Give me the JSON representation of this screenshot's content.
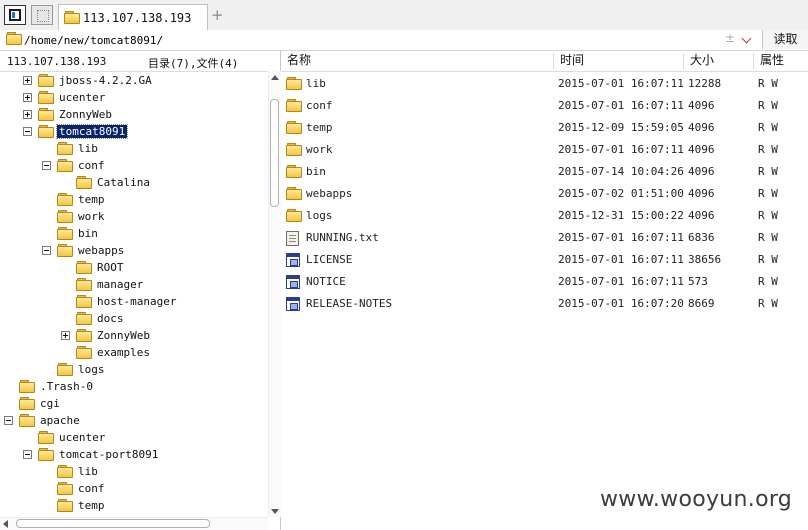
{
  "tabbar": {
    "tab_title": "113.107.138.193",
    "add_tab": "+"
  },
  "address": {
    "path": "/home/new/tomcat8091/",
    "pm": "±",
    "read_label": "读取"
  },
  "left": {
    "host": "113.107.138.193",
    "counts": "目录(7),文件(4)"
  },
  "tree": [
    {
      "label": "jboss-4.2.2.GA",
      "expander": "plus"
    },
    {
      "label": "ucenter",
      "expander": "plus"
    },
    {
      "label": "ZonnyWeb",
      "expander": "plus"
    },
    {
      "label": "tomcat8091",
      "expander": "minus",
      "selected": true
    },
    {
      "label": "lib",
      "expander": "none"
    },
    {
      "label": "conf",
      "expander": "minus"
    },
    {
      "label": "Catalina",
      "expander": "none"
    },
    {
      "label": "temp",
      "expander": "none"
    },
    {
      "label": "work",
      "expander": "none"
    },
    {
      "label": "bin",
      "expander": "none"
    },
    {
      "label": "webapps",
      "expander": "minus"
    },
    {
      "label": "ROOT",
      "expander": "none"
    },
    {
      "label": "manager",
      "expander": "none"
    },
    {
      "label": "host-manager",
      "expander": "none"
    },
    {
      "label": "docs",
      "expander": "none"
    },
    {
      "label": "ZonnyWeb",
      "expander": "plus"
    },
    {
      "label": "examples",
      "expander": "none"
    },
    {
      "label": "logs",
      "expander": "none"
    },
    {
      "label": ".Trash-0",
      "expander": "none"
    },
    {
      "label": "cgi",
      "expander": "none"
    },
    {
      "label": "apache",
      "expander": "minus"
    },
    {
      "label": "ucenter",
      "expander": "none"
    },
    {
      "label": "tomcat-port8091",
      "expander": "minus"
    },
    {
      "label": "lib",
      "expander": "none"
    },
    {
      "label": "conf",
      "expander": "none"
    },
    {
      "label": "temp",
      "expander": "none"
    }
  ],
  "columns": {
    "name": "名称",
    "time": "时间",
    "size": "大小",
    "attr": "属性"
  },
  "files": [
    {
      "icon": "folder",
      "name": "lib",
      "time": "2015-07-01 16:07:11",
      "size": "12288",
      "attr": "R W"
    },
    {
      "icon": "folder",
      "name": "conf",
      "time": "2015-07-01 16:07:11",
      "size": "4096",
      "attr": "R W"
    },
    {
      "icon": "folder",
      "name": "temp",
      "time": "2015-12-09 15:59:05",
      "size": "4096",
      "attr": "R W"
    },
    {
      "icon": "folder",
      "name": "work",
      "time": "2015-07-01 16:07:11",
      "size": "4096",
      "attr": "R W"
    },
    {
      "icon": "folder",
      "name": "bin",
      "time": "2015-07-14 10:04:26",
      "size": "4096",
      "attr": "R W"
    },
    {
      "icon": "folder",
      "name": "webapps",
      "time": "2015-07-02 01:51:00",
      "size": "4096",
      "attr": "R W"
    },
    {
      "icon": "folder",
      "name": "logs",
      "time": "2015-12-31 15:00:22",
      "size": "4096",
      "attr": "R W"
    },
    {
      "icon": "text-file",
      "name": "RUNNING.txt",
      "time": "2015-07-01 16:07:11",
      "size": "6836",
      "attr": "R W"
    },
    {
      "icon": "binary-file",
      "name": "LICENSE",
      "time": "2015-07-01 16:07:11",
      "size": "38656",
      "attr": "R W"
    },
    {
      "icon": "binary-file",
      "name": "NOTICE",
      "time": "2015-07-01 16:07:11",
      "size": "573",
      "attr": "R W"
    },
    {
      "icon": "binary-file",
      "name": "RELEASE-NOTES",
      "time": "2015-07-01 16:07:20",
      "size": "8669",
      "attr": "R W"
    }
  ],
  "watermark": "www.wooyun.org"
}
